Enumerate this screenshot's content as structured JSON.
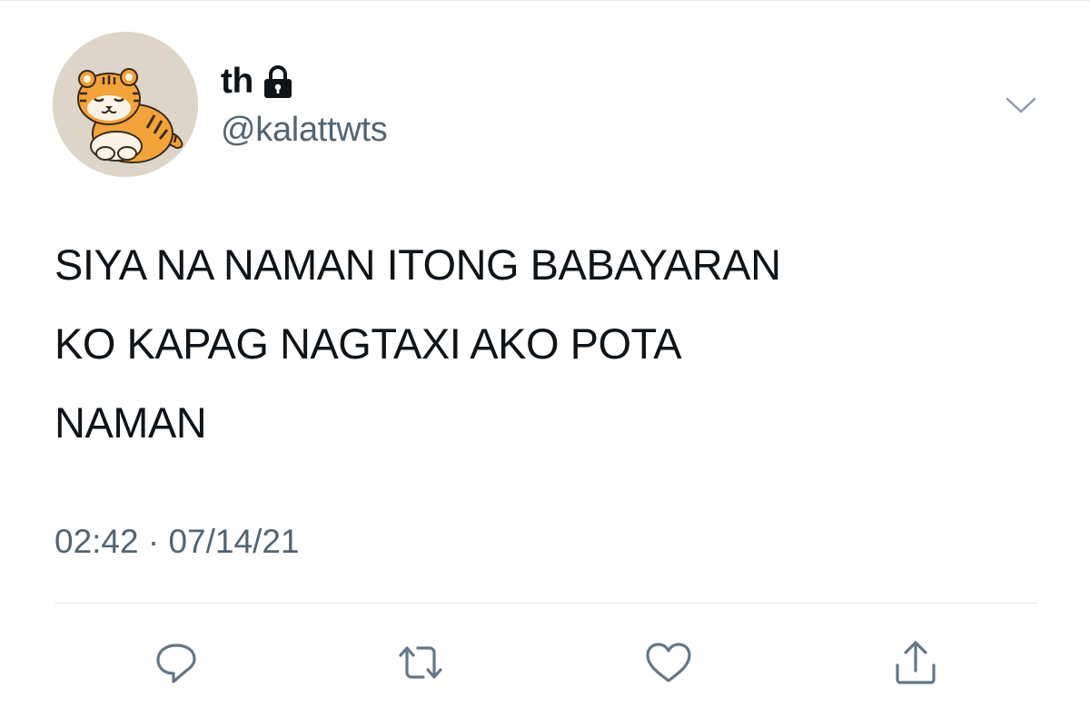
{
  "tweet": {
    "author": {
      "display_name": "th",
      "handle": "@kalattwts",
      "protected": true,
      "avatar": "tiger-avatar"
    },
    "text": "SIYA NA NAMAN ITONG BABAYARAN\nKO KAPAG NAGTAXI AKO POTA\nNAMAN",
    "time": "02:42",
    "separator": "·",
    "date": "07/14/21"
  },
  "icons": {
    "lock": "lock-icon",
    "more": "chevron-down-icon",
    "reply": "reply-icon",
    "retweet": "retweet-icon",
    "like": "heart-icon",
    "share": "share-icon"
  },
  "colors": {
    "text_primary": "#0f1419",
    "text_secondary": "#536471",
    "icon_gray": "#657786",
    "divider": "#e1e8ed",
    "avatar_bg": "#ddd5c7"
  }
}
